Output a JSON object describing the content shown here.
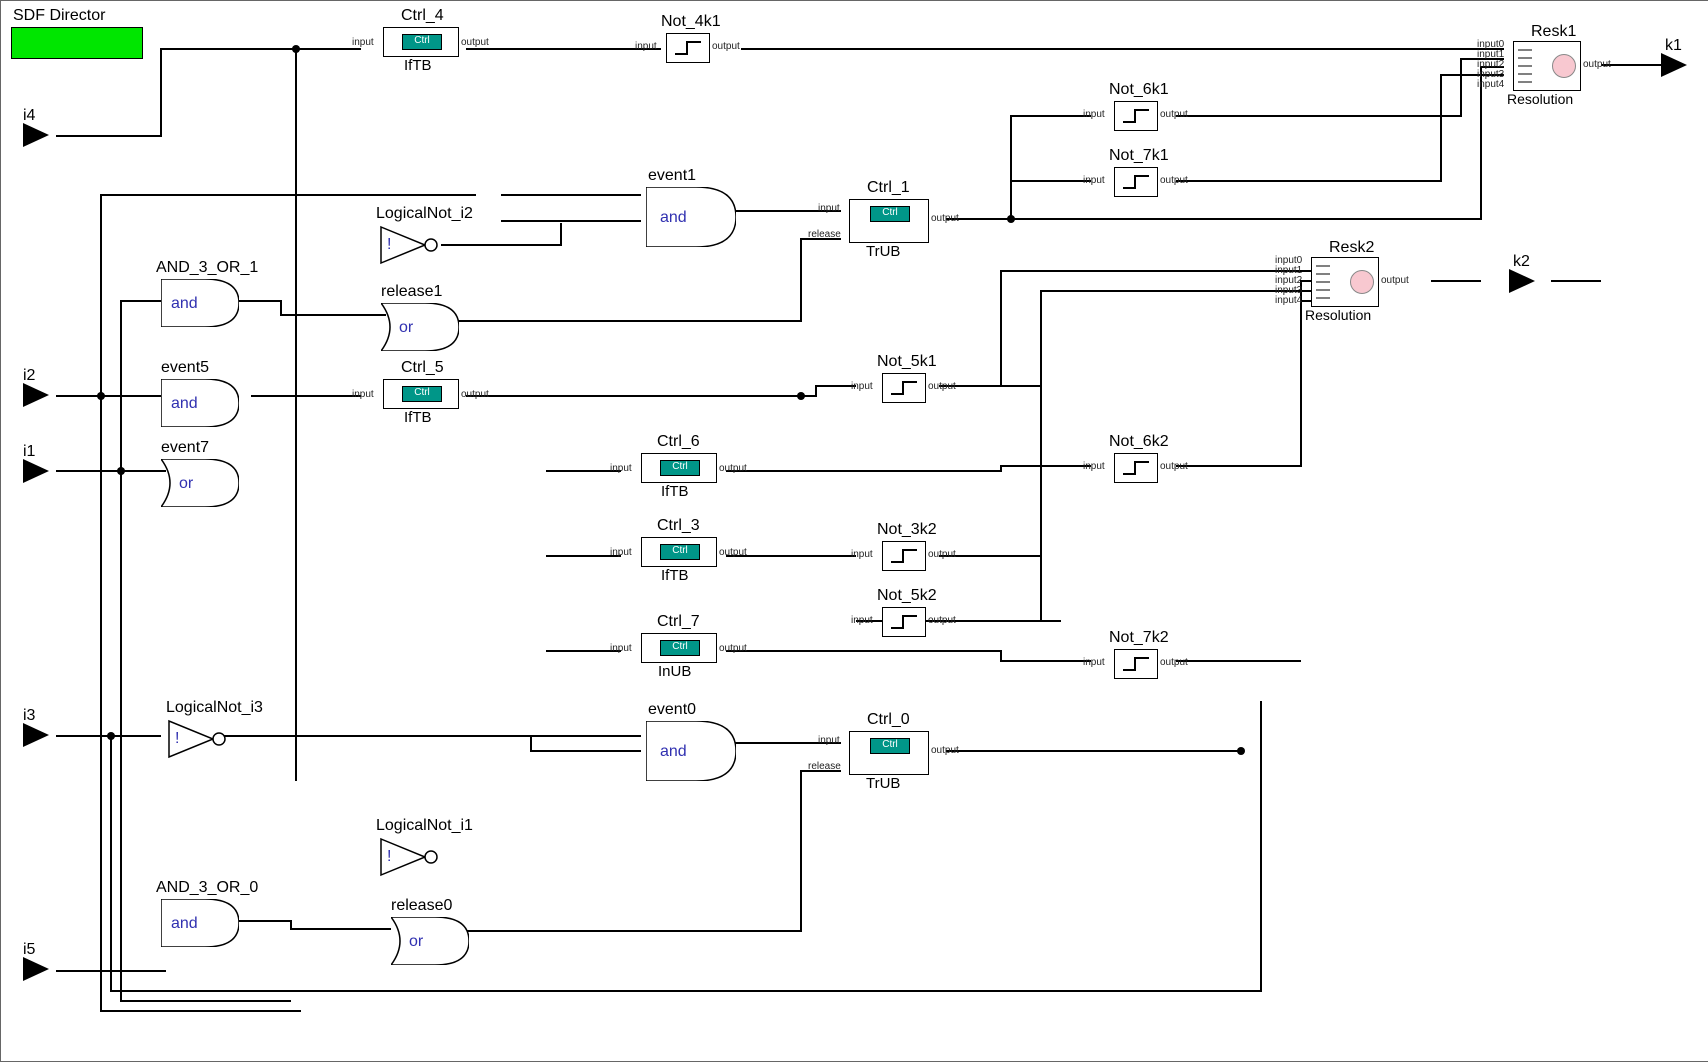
{
  "director": "SDF Director",
  "inputs": {
    "i4": "i4",
    "i2": "i2",
    "i1": "i1",
    "i3": "i3",
    "i5": "i5"
  },
  "outputs": {
    "k1": "k1",
    "k2": "k2"
  },
  "gates": {
    "and_3_or_1": {
      "name": "AND_3_OR_1",
      "text": "and"
    },
    "event5": {
      "name": "event5",
      "text": "and"
    },
    "event7": {
      "name": "event7",
      "text": "or"
    },
    "and_3_or_0": {
      "name": "AND_3_OR_0",
      "text": "and"
    },
    "release1": {
      "name": "release1",
      "text": "or"
    },
    "release0": {
      "name": "release0",
      "text": "or"
    },
    "event1": {
      "name": "event1",
      "text": "and"
    },
    "event0": {
      "name": "event0",
      "text": "and"
    },
    "lnot_i2": {
      "name": "LogicalNot_i2",
      "text": "!"
    },
    "lnot_i3": {
      "name": "LogicalNot_i3",
      "text": "!"
    },
    "lnot_i1": {
      "name": "LogicalNot_i1",
      "text": "!"
    }
  },
  "ctrl": {
    "c4": {
      "name": "Ctrl_4",
      "btn": "Ctrl",
      "sub": "IfTB"
    },
    "c5": {
      "name": "Ctrl_5",
      "btn": "Ctrl",
      "sub": "IfTB"
    },
    "c6": {
      "name": "Ctrl_6",
      "btn": "Ctrl",
      "sub": "IfTB"
    },
    "c3": {
      "name": "Ctrl_3",
      "btn": "Ctrl",
      "sub": "IfTB"
    },
    "c7": {
      "name": "Ctrl_7",
      "btn": "Ctrl",
      "sub": "InUB"
    },
    "c1": {
      "name": "Ctrl_1",
      "btn": "Ctrl",
      "sub": "TrUB"
    },
    "c0": {
      "name": "Ctrl_0",
      "btn": "Ctrl",
      "sub": "TrUB"
    }
  },
  "nots": {
    "n4k1": "Not_4k1",
    "n6k1": "Not_6k1",
    "n7k1": "Not_7k1",
    "n5k1": "Not_5k1",
    "n6k2": "Not_6k2",
    "n3k2": "Not_3k2",
    "n5k2": "Not_5k2",
    "n7k2": "Not_7k2"
  },
  "res": {
    "r1": {
      "name": "Resk1",
      "sub": "Resolution"
    },
    "r2": {
      "name": "Resk2",
      "sub": "Resolution"
    }
  },
  "portnames": {
    "input": "input",
    "output": "output",
    "release": "release",
    "input0": "input0",
    "input1": "input1",
    "input2": "input2",
    "input3": "input3",
    "input4": "input4"
  }
}
